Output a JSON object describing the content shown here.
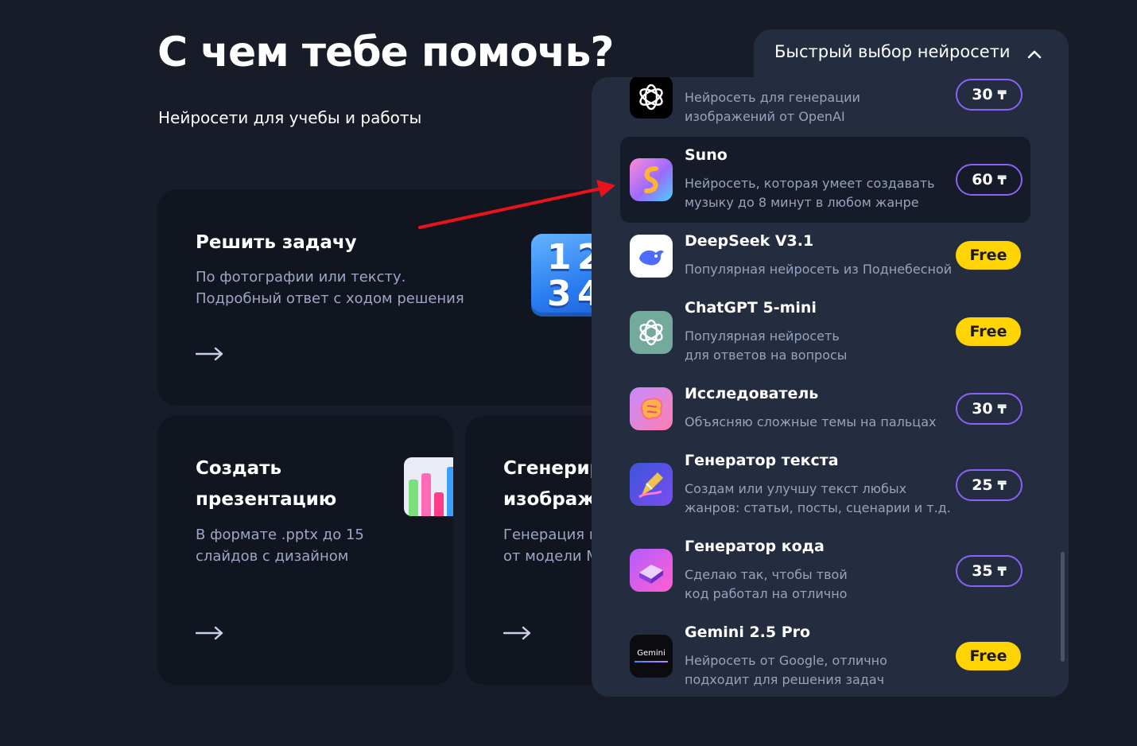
{
  "header": {
    "title": "С чем тебе помочь?",
    "subtitle": "Нейросети для учебы и работы"
  },
  "cards": [
    {
      "title": "Решить задачу",
      "desc_lines": [
        "По фотографии или тексту.",
        "Подробный ответ с ходом решения"
      ],
      "tile_digits": [
        "1",
        "2",
        "3",
        "4"
      ]
    },
    {
      "title_lines": [
        "Создать",
        "презентацию"
      ],
      "desc_lines": [
        "В формате .pptx до 15",
        "слайдов с дизайном"
      ]
    },
    {
      "title_lines": [
        "Сгенерир",
        "изображе"
      ],
      "desc_lines": [
        "Генерация и",
        "от модели M"
      ]
    }
  ],
  "quick_select": {
    "label": "Быстрый выбор нейросети",
    "items": [
      {
        "name": "",
        "desc_lines": [
          "Нейросеть для генерации",
          "изображений от OpenAI"
        ],
        "price": "30",
        "icon": "openai-icon"
      },
      {
        "name": "Suno",
        "desc_lines": [
          "Нейросеть, которая умеет создавать",
          "музыку до 8 минут в любом жанре"
        ],
        "price": "60",
        "icon": "suno-icon"
      },
      {
        "name": "DeepSeek V3.1",
        "desc_lines": [
          "Популярная нейросеть из Поднебесной"
        ],
        "price": "Free",
        "icon": "deepseek-whale-icon"
      },
      {
        "name": "ChatGPT 5-mini",
        "desc_lines": [
          "Популярная нейросеть",
          "для ответов на вопросы"
        ],
        "price": "Free",
        "icon": "openai-icon"
      },
      {
        "name": "Исследователь",
        "desc_lines": [
          "Объясняю сложные темы на пальцах"
        ],
        "price": "30",
        "icon": "brain-icon"
      },
      {
        "name": "Генератор текста",
        "desc_lines": [
          "Создам или улучшу текст любых",
          "жанров: статьи, посты, сценарии и т.д."
        ],
        "price": "25",
        "icon": "pen-icon"
      },
      {
        "name": "Генератор кода",
        "desc_lines": [
          "Сделаю так, чтобы твой",
          "код работал на отлично"
        ],
        "price": "35",
        "icon": "code-cube-icon"
      },
      {
        "name": "Gemini 2.5 Pro",
        "desc_lines": [
          "Нейросеть от Google, отлично",
          "подходит для решения задач"
        ],
        "price": "Free",
        "icon": "gemini-icon",
        "icon_text": "Gemini"
      }
    ]
  },
  "currency_symbol": "₸",
  "colors": {
    "background": "#171c28",
    "card": "#101520",
    "panel": "#242c3f",
    "price_border": "#8a63f5",
    "free_badge": "#ffd400",
    "annotation_arrow": "#e8131b"
  }
}
